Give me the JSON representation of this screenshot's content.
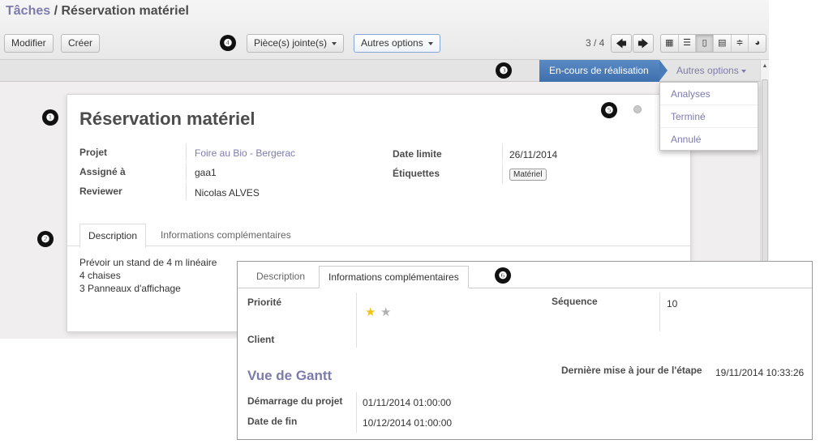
{
  "breadcrumb": {
    "parent": "Tâches",
    "separator": "/",
    "current": "Réservation matériel"
  },
  "toolbar": {
    "edit_label": "Modifier",
    "create_label": "Créer",
    "attachments_label": "Pièce(s) jointe(s)",
    "more_label": "Autres options"
  },
  "pager": {
    "text": "3 / 4"
  },
  "statusbar": {
    "active_stage": "En-cours de réalisation",
    "more_label": "Autres options",
    "menu_items": [
      "Analyses",
      "Terminé",
      "Annulé"
    ]
  },
  "form": {
    "title": "Réservation matériel",
    "fields": {
      "project_label": "Projet",
      "project_value": "Foire au Bio - Bergerac",
      "assigned_label": "Assigné à",
      "assigned_value": "gaa1",
      "reviewer_label": "Reviewer",
      "reviewer_value": "Nicolas ALVES",
      "deadline_label": "Date limite",
      "deadline_value": "26/11/2014",
      "tags_label": "Étiquettes",
      "tags_value": "Matériel"
    },
    "tabs": [
      "Description",
      "Informations complémentaires"
    ],
    "description_lines": [
      "Prévoir un stand de 4 m linéaire",
      "4 chaises",
      "3 Panneaux d'affichage"
    ]
  },
  "panel": {
    "tabs": [
      "Description",
      "Informations complémentaires"
    ],
    "priority_label": "Priorité",
    "priority_stars": 1,
    "priority_max": 2,
    "client_label": "Client",
    "sequence_label": "Séquence",
    "sequence_value": "10",
    "gantt_title": "Vue de Gantt",
    "last_stage_update_label": "Dernière mise à jour de l'étape",
    "last_stage_update_value": "19/11/2014 10:33:26",
    "project_start_label": "Démarrage du projet",
    "project_start_value": "01/11/2014 01:00:00",
    "end_date_label": "Date de fin",
    "end_date_value": "10/12/2014 01:00:00"
  },
  "callouts": [
    "❶",
    "❷",
    "❸",
    "❹",
    "❺",
    "❻"
  ],
  "colors": {
    "accent": "#7c7bad",
    "stage_active": "#4a7bb8"
  },
  "icons": {
    "prev": "arrow-left-icon",
    "next": "arrow-right-icon",
    "views": [
      "kanban-icon",
      "list-icon",
      "form-icon",
      "calendar-icon",
      "gantt-icon",
      "graph-icon"
    ]
  }
}
